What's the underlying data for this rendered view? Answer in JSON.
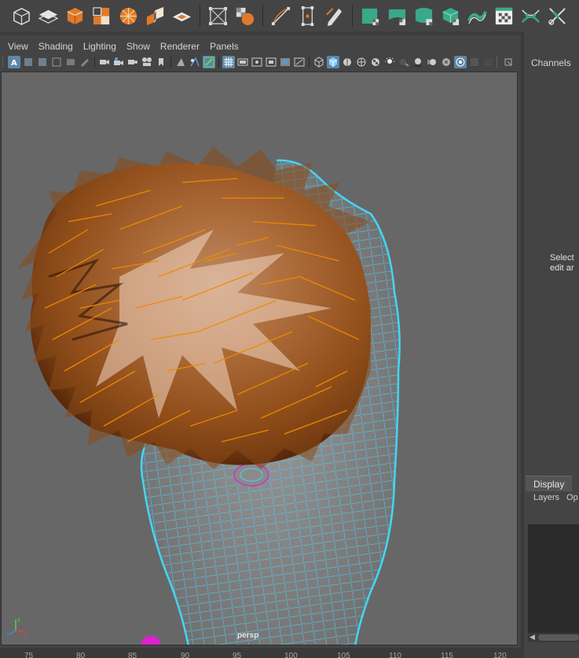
{
  "shelf": {
    "icons": [
      "cube-wireframe-icon",
      "plane-layers-icon",
      "cube-orange-icon",
      "split-cubes-icon",
      "soccer-ball-icon",
      "cube-bridge-icon",
      "flat-disc-icon",
      "bounding-box-icon",
      "sphere-grid-icon",
      "draw-curve-icon",
      "bounds-select-icon",
      "pencil-edit-icon",
      "green-block-icon",
      "curve-warp-icon",
      "bend-shape-icon",
      "cube-green-checker-icon",
      "twisted-curve-icon",
      "checker-window-icon",
      "crossing-curves-icon",
      "scissors-cross-icon"
    ]
  },
  "panel_menu": {
    "items": [
      "View",
      "Shading",
      "Lighting",
      "Show",
      "Renderer",
      "Panels"
    ]
  },
  "viewport": {
    "camera": "persp"
  },
  "timeslider": {
    "ticks": [
      "75",
      "80",
      "85",
      "90",
      "95",
      "100",
      "105",
      "110",
      "115",
      "120"
    ]
  },
  "channel_box": {
    "title": "Channels",
    "hint": "Select\nedit ar"
  },
  "layer_editor": {
    "tab_display": "Display",
    "sub_layers": "Layers",
    "sub_options": "Op"
  },
  "colors": {
    "accent_blue": "#5d87a8",
    "wire_cyan": "#43d6f5",
    "vertex_magenta": "#cc33cc",
    "hair_orange": "#f08a00",
    "shelf_orange": "#e07a2a",
    "shelf_green": "#3aa88a"
  }
}
